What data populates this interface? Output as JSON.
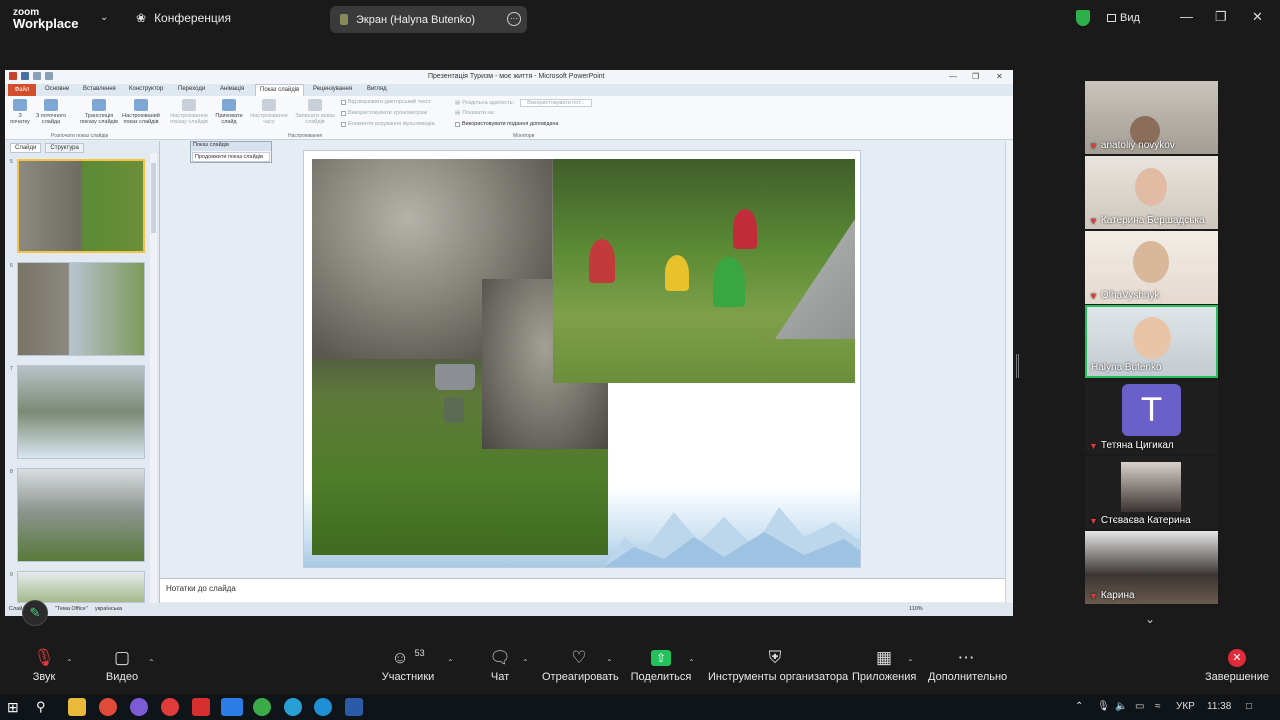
{
  "topbar": {
    "brand_line1": "zoom",
    "brand_line2": "Workplace",
    "conference_label": "Конференция",
    "screen_share_label": "Экран (Halyna Butenko)",
    "view_label": "Вид"
  },
  "powerpoint": {
    "window_title": "Презентація Туризм - моє життя - Microsoft PowerPoint",
    "tabs": [
      "Файл",
      "Основне",
      "Вставлення",
      "Конструктор",
      "Переходи",
      "Анімація",
      "Показ слайдів",
      "Рецензування",
      "Вигляд"
    ],
    "active_tab": "Показ слайдів",
    "ribbon": {
      "from_start": "З початку",
      "from_current": "З поточного слайда",
      "broadcast": "Трансляція показу слайдів",
      "custom_show": "Настроюваний показ слайдів",
      "group_start": "Розпочати показ слайдів",
      "setup_show": "Настроювання показу слайдів",
      "hide_slide": "Приховати слайд",
      "rehearse": "Настроювання часу",
      "record": "Записати показ слайдів",
      "group_setup": "Настроювання",
      "opt_narration": "Відтворювати дикторський текст",
      "opt_timings": "Використовувати хронометраж",
      "opt_media": "Елементи керування мультимедіа",
      "resolution_label": "Роздільна здатність:",
      "resolution_value": "Використовувати пот...",
      "show_on_label": "Показати на:",
      "presenter_view": "Використовувати подання доповідача",
      "group_monitors": "Монітори"
    },
    "pane_tabs": [
      "Слайди",
      "Структура"
    ],
    "thumb_numbers": [
      "5",
      "6",
      "7",
      "8",
      "9"
    ],
    "popup_title": "Показ слайдів",
    "popup_button": "Продовжити показ слайдів",
    "notes_placeholder": "Нотатки до слайда",
    "status": {
      "slide": "Слай",
      "theme": "\"Тема Office\"",
      "language": "українська",
      "zoom": "110%"
    }
  },
  "participants": [
    {
      "name": "anatoliy novykov",
      "muted": true
    },
    {
      "name": "Катерина Бершадська",
      "muted": true
    },
    {
      "name": "OlhaVyshnyk",
      "muted": true
    },
    {
      "name": "Halyna Butenko",
      "muted": false,
      "active": true
    },
    {
      "name": "Тетяна Цигикал",
      "muted": true,
      "avatar_letter": "T"
    },
    {
      "name": "Стєваєва Катерина",
      "muted": true
    },
    {
      "name": "Карина",
      "muted": true
    }
  ],
  "toolbar": {
    "audio": "Звук",
    "video": "Видео",
    "participants": "Участники",
    "participants_count": "53",
    "chat": "Чат",
    "react": "Отреагировать",
    "share": "Поделиться",
    "host_tools": "Инструменты организатора",
    "apps": "Приложения",
    "more": "Дополнительно",
    "end": "Завершение"
  },
  "taskbar": {
    "language": "УКР",
    "time": "11:38"
  },
  "colors": {
    "zoom_bg": "#1a1a1a",
    "active_speaker": "#25c05b",
    "share_green": "#23c15b",
    "end_red": "#e02b3a",
    "muted_red": "#e23b3b"
  }
}
